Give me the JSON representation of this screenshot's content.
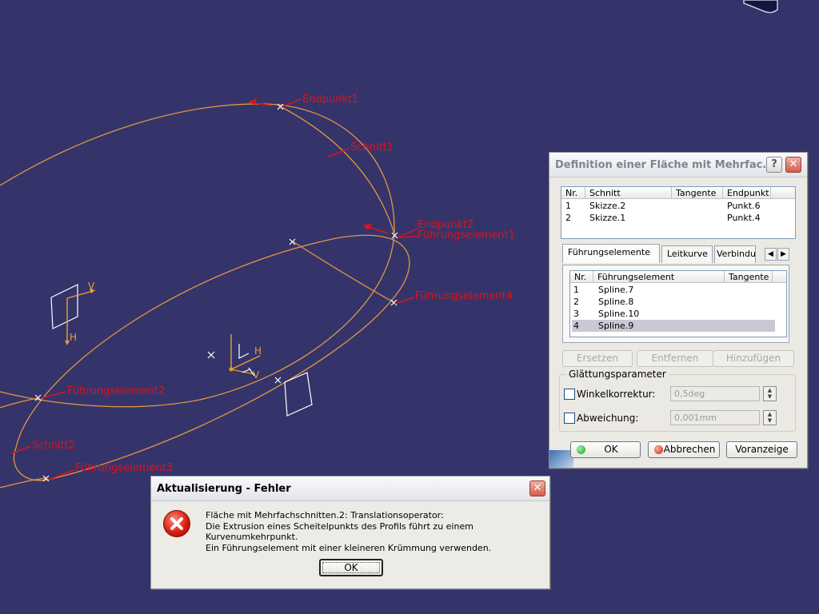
{
  "viewport": {
    "labels": {
      "endpunkt1": "Endpunkt1",
      "schnitt1": "Schnitt1",
      "endpunkt2": "Endpunkt2",
      "fuehrung1": "Führungselement1",
      "fuehrung4": "Führungselement4",
      "fuehrung2": "Führungselement2",
      "schnitt2": "Schnitt2",
      "fuehrung3": "Führungselement3"
    },
    "axes": {
      "v": "V",
      "h": "H"
    },
    "colors": {
      "background": "#34346b",
      "curve": "#e2963f",
      "label": "#e0101a"
    }
  },
  "surface_dialog": {
    "title": "Definition einer Fläche mit Mehrfac...",
    "help_label": "?",
    "close_label": "✕",
    "sections_table": {
      "headers": [
        "Nr.",
        "Schnitt",
        "Tangente",
        "Endpunkt"
      ],
      "rows": [
        {
          "nr": "1",
          "schnitt": "Skizze.2",
          "tangente": "",
          "endpunkt": "Punkt.6"
        },
        {
          "nr": "2",
          "schnitt": "Skizze.1",
          "tangente": "",
          "endpunkt": "Punkt.4"
        }
      ]
    },
    "tabs": [
      "Führungselemente",
      "Leitkurve",
      "Verbindu"
    ],
    "guides_table": {
      "headers": [
        "Nr.",
        "Führungselement",
        "Tangente"
      ],
      "rows": [
        {
          "nr": "1",
          "element": "Spline.7"
        },
        {
          "nr": "2",
          "element": "Spline.8"
        },
        {
          "nr": "3",
          "element": "Spline.10"
        },
        {
          "nr": "4",
          "element": "Spline.9",
          "selected": true
        }
      ]
    },
    "buttons": {
      "replace": "Ersetzen",
      "remove": "Entfernen",
      "add": "Hinzufügen"
    },
    "smoothing": {
      "group_label": "Glättungsparameter",
      "angle_label": "Winkelkorrektur:",
      "angle_value": "0,5deg",
      "deviation_label": "Abweichung:",
      "deviation_value": "0,001mm"
    },
    "footer": {
      "ok": "OK",
      "cancel": "Abbrechen",
      "preview": "Voranzeige"
    }
  },
  "error_dialog": {
    "title": "Aktualisierung - Fehler",
    "close_label": "✕",
    "lines": [
      "Fläche mit Mehrfachschnitten.2: Translationsoperator:",
      "Die Extrusion eines Scheitelpunkts des Profils führt zu einem Kurvenumkehrpunkt.",
      "Ein Führungselement mit einer kleineren Krümmung verwenden."
    ],
    "ok": "OK"
  }
}
